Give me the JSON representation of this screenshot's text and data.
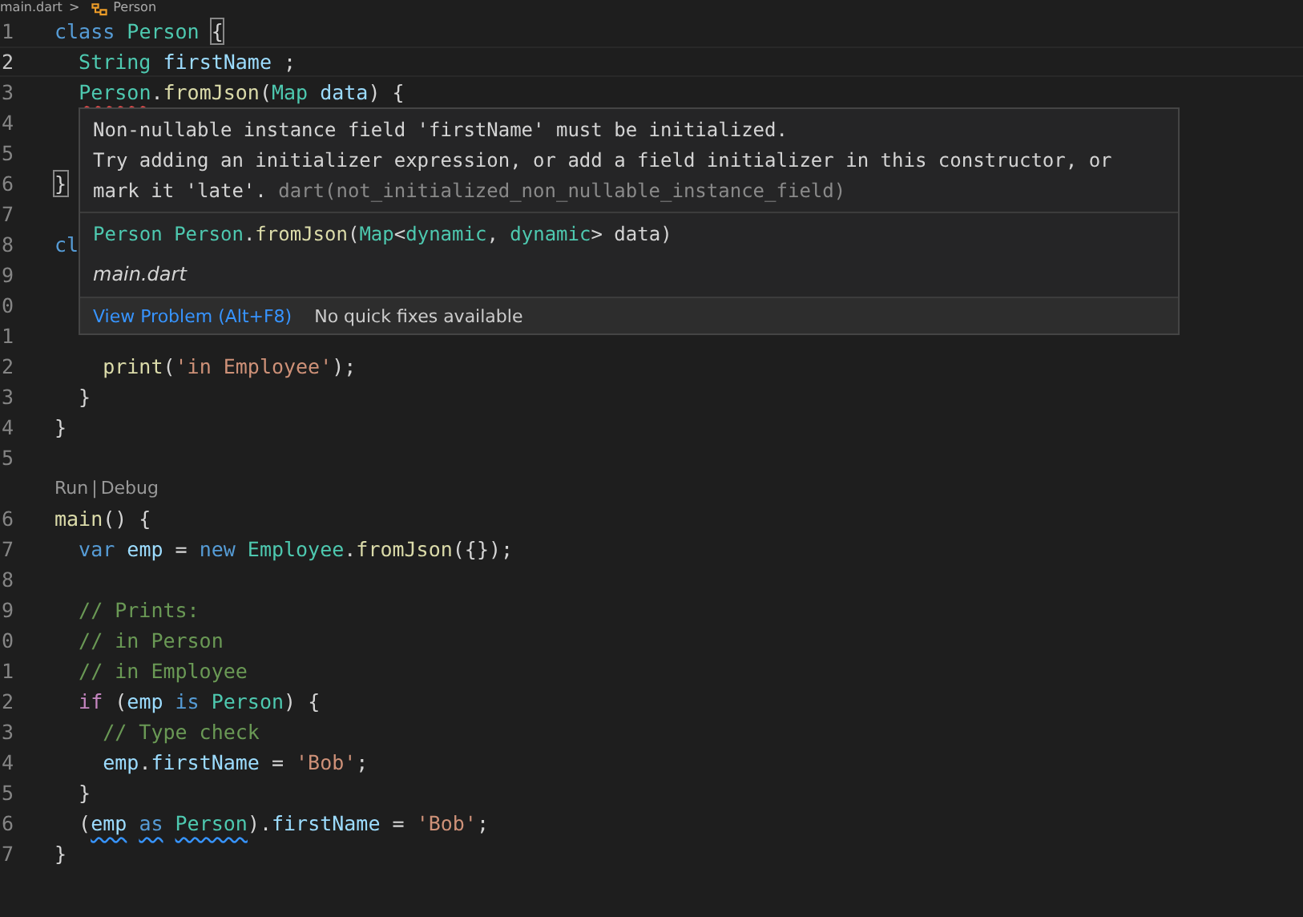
{
  "breadcrumb": {
    "file": "main.dart",
    "separator": ">",
    "symbol": "Person"
  },
  "lines": [
    {
      "kind": "code",
      "number": "1",
      "current": false,
      "tokens": [
        {
          "text": "class",
          "kind": "keyword"
        },
        {
          "text": " Person",
          "kind": "type"
        },
        {
          "text": " {",
          "kind": "plain",
          "bracket_match": true
        }
      ]
    },
    {
      "kind": "code",
      "number": "2",
      "current": true,
      "tokens": [
        {
          "text": "  String",
          "kind": "type"
        },
        {
          "text": " firstName",
          "kind": "variable"
        },
        {
          "text": " ;",
          "kind": "plain"
        }
      ]
    },
    {
      "kind": "code",
      "number": "3",
      "current": false,
      "tokens": [
        {
          "text": "  Person",
          "kind": "type",
          "squiggle_error": true
        },
        {
          "text": ".",
          "kind": "plain"
        },
        {
          "text": "fromJson",
          "kind": "function"
        },
        {
          "text": "(",
          "kind": "plain"
        },
        {
          "text": "Map",
          "kind": "type"
        },
        {
          "text": " data",
          "kind": "variable"
        },
        {
          "text": ") {",
          "kind": "plain"
        }
      ]
    },
    {
      "kind": "code",
      "number": "4",
      "current": false
    },
    {
      "kind": "code",
      "number": "5",
      "current": false
    },
    {
      "kind": "code",
      "number": "6",
      "current": false,
      "tokens": [
        {
          "text": "}",
          "kind": "plain",
          "bracket_match": true
        }
      ]
    },
    {
      "kind": "code",
      "number": "7",
      "current": false
    },
    {
      "kind": "code",
      "number": "8",
      "current": false,
      "tokens": [
        {
          "text": "cl",
          "kind": "keyword"
        }
      ]
    },
    {
      "kind": "code",
      "number": "9",
      "current": false
    },
    {
      "kind": "code",
      "number": "0",
      "current": false
    },
    {
      "kind": "code",
      "number": "1",
      "current": false
    },
    {
      "kind": "code",
      "number": "2",
      "current": false,
      "tokens": [
        {
          "text": "    print",
          "kind": "function"
        },
        {
          "text": "(",
          "kind": "plain"
        },
        {
          "text": "'in Employee'",
          "kind": "string"
        },
        {
          "text": ");",
          "kind": "plain"
        }
      ]
    },
    {
      "kind": "code",
      "number": "3",
      "current": false,
      "tokens": [
        {
          "text": "  }",
          "kind": "plain"
        }
      ]
    },
    {
      "kind": "code",
      "number": "4",
      "current": false,
      "tokens": [
        {
          "text": "}",
          "kind": "plain"
        }
      ]
    },
    {
      "kind": "code",
      "number": "5",
      "current": false
    },
    {
      "kind": "codelens",
      "items": [
        "Run",
        "Debug"
      ],
      "separator": "|"
    },
    {
      "kind": "code",
      "number": "6",
      "current": false,
      "tokens": [
        {
          "text": "main",
          "kind": "function"
        },
        {
          "text": "() {",
          "kind": "plain"
        }
      ]
    },
    {
      "kind": "code",
      "number": "7",
      "current": false,
      "tokens": [
        {
          "text": "  var",
          "kind": "keyword"
        },
        {
          "text": " emp",
          "kind": "variable"
        },
        {
          "text": " = ",
          "kind": "plain"
        },
        {
          "text": "new",
          "kind": "keyword"
        },
        {
          "text": " Employee",
          "kind": "type"
        },
        {
          "text": ".",
          "kind": "plain"
        },
        {
          "text": "fromJson",
          "kind": "function"
        },
        {
          "text": "({});",
          "kind": "plain"
        }
      ]
    },
    {
      "kind": "code",
      "number": "8",
      "current": false
    },
    {
      "kind": "code",
      "number": "9",
      "current": false,
      "tokens": [
        {
          "text": "  // Prints:",
          "kind": "comment"
        }
      ]
    },
    {
      "kind": "code",
      "number": "0",
      "current": false,
      "tokens": [
        {
          "text": "  // in Person",
          "kind": "comment"
        }
      ]
    },
    {
      "kind": "code",
      "number": "1",
      "current": false,
      "tokens": [
        {
          "text": "  // in Employee",
          "kind": "comment"
        }
      ]
    },
    {
      "kind": "code",
      "number": "2",
      "current": false,
      "tokens": [
        {
          "text": "  if",
          "kind": "control"
        },
        {
          "text": " (",
          "kind": "plain"
        },
        {
          "text": "emp",
          "kind": "variable"
        },
        {
          "text": " is",
          "kind": "keyword"
        },
        {
          "text": " Person",
          "kind": "type"
        },
        {
          "text": ") {",
          "kind": "plain"
        }
      ]
    },
    {
      "kind": "code",
      "number": "3",
      "current": false,
      "tokens": [
        {
          "text": "    // Type check",
          "kind": "comment"
        }
      ]
    },
    {
      "kind": "code",
      "number": "4",
      "current": false,
      "tokens": [
        {
          "text": "    emp",
          "kind": "variable"
        },
        {
          "text": ".",
          "kind": "plain"
        },
        {
          "text": "firstName",
          "kind": "variable"
        },
        {
          "text": " = ",
          "kind": "plain"
        },
        {
          "text": "'Bob'",
          "kind": "string"
        },
        {
          "text": ";",
          "kind": "plain"
        }
      ]
    },
    {
      "kind": "code",
      "number": "5",
      "current": false,
      "tokens": [
        {
          "text": "  }",
          "kind": "plain"
        }
      ]
    },
    {
      "kind": "code",
      "number": "6",
      "current": false,
      "tokens": [
        {
          "text": "  (",
          "kind": "plain"
        },
        {
          "text": "emp",
          "kind": "variable",
          "squiggle_info": true
        },
        {
          "text": " as",
          "kind": "keyword",
          "squiggle_info": true
        },
        {
          "text": " Person",
          "kind": "type",
          "squiggle_info": true
        },
        {
          "text": ").",
          "kind": "plain"
        },
        {
          "text": "firstName",
          "kind": "variable"
        },
        {
          "text": " = ",
          "kind": "plain"
        },
        {
          "text": "'Bob'",
          "kind": "string"
        },
        {
          "text": ";",
          "kind": "plain"
        }
      ]
    },
    {
      "kind": "code",
      "number": "7",
      "current": false,
      "tokens": [
        {
          "text": "}",
          "kind": "plain"
        }
      ]
    }
  ],
  "hover": {
    "message": "Non-nullable instance field 'firstName' must be initialized.\nTry adding an initializer expression, or add a field initializer in this constructor, or\nmark it 'late'.",
    "source": "dart(not_initialized_non_nullable_instance_field)",
    "signature": [
      {
        "text": "Person",
        "kind": "type"
      },
      {
        "text": " Person",
        "kind": "type"
      },
      {
        "text": ".",
        "kind": "plain"
      },
      {
        "text": "fromJson",
        "kind": "function"
      },
      {
        "text": "(",
        "kind": "plain"
      },
      {
        "text": "Map",
        "kind": "type"
      },
      {
        "text": "<",
        "kind": "plain"
      },
      {
        "text": "dynamic",
        "kind": "type"
      },
      {
        "text": ", ",
        "kind": "plain"
      },
      {
        "text": "dynamic",
        "kind": "type"
      },
      {
        "text": "> data)",
        "kind": "plain"
      }
    ],
    "file": "main.dart",
    "action": "View Problem (Alt+F8)",
    "note": "No quick fixes available"
  }
}
